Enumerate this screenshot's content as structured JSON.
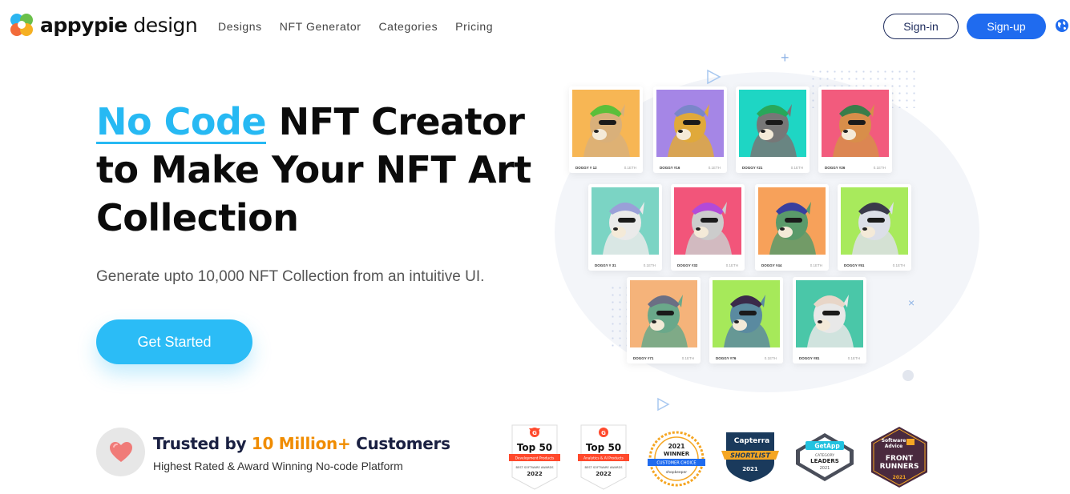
{
  "brand": {
    "logo_bold": "appypie",
    "logo_light": " design",
    "logo_icon": "appypie-logo-icon"
  },
  "nav": {
    "items": [
      {
        "label": "Designs"
      },
      {
        "label": "NFT Generator"
      },
      {
        "label": "Categories"
      },
      {
        "label": "Pricing"
      }
    ]
  },
  "header": {
    "signin_label": "Sign-in",
    "signup_label": "Sign-up",
    "language_icon": "globe-icon"
  },
  "hero": {
    "title_highlight": "No Code",
    "title_rest_1": " NFT Creator",
    "title_line_2": "to Make Your NFT Art",
    "title_line_3": "Collection",
    "subtitle": "Generate upto 10,000 NFT Collection from an intuitive UI.",
    "cta_label": "Get Started"
  },
  "trust": {
    "title_prefix": "Trusted by ",
    "title_highlight": "10 Million+",
    "title_suffix": " Customers",
    "subtitle": "Highest Rated & Award Winning No-code Platform",
    "icon": "heart-icon"
  },
  "badges": [
    {
      "name": "g2-top50-dev",
      "line1": "Top 50",
      "line2": "Development Products",
      "line3": "BEST SOFTWARE AWARDS",
      "year": "2022"
    },
    {
      "name": "g2-top50-ai",
      "line1": "Top 50",
      "line2": "Analytics & AI Products",
      "line3": "BEST SOFTWARE AWARDS",
      "year": "2022"
    },
    {
      "name": "capterra-winner",
      "line1": "2021",
      "line2": "WINNER",
      "line3": "CUSTOMER CHOICE",
      "line4": "shopkeeper"
    },
    {
      "name": "capterra-shortlist",
      "line1": "Capterra",
      "line2": "SHORTLIST",
      "year": "2021"
    },
    {
      "name": "getapp-leaders",
      "line1": "GetApp",
      "line2": "CATEGORY",
      "line3": "LEADERS",
      "year": "2021"
    },
    {
      "name": "software-advice",
      "line1": "Software",
      "line2": "Advice",
      "line3": "FRONT",
      "line4": "RUNNERS",
      "year": "2021"
    }
  ],
  "nft_cards": [
    {
      "name": "DOGGY # 12",
      "eth": "0.1ETH",
      "bg": "#f7b654",
      "hat": "#5bbf3a",
      "fur": "#d9b07a"
    },
    {
      "name": "DOGGY #16",
      "eth": "0.1ETH",
      "bg": "#a586e6",
      "hat": "#7a86c9",
      "fur": "#e0a93a"
    },
    {
      "name": "DOGGY #21",
      "eth": "0.1ETH",
      "bg": "#1ed6c4",
      "hat": "#28a85a",
      "fur": "#777777"
    },
    {
      "name": "DOGGY #26",
      "eth": "0.1ETH",
      "bg": "#f25b7d",
      "hat": "#3a7d4a",
      "fur": "#d88e4a"
    },
    {
      "name": "DOGGY # 31",
      "eth": "0.1ETH",
      "bg": "#7bd4c4",
      "hat": "#9aa0d8",
      "fur": "#eaeaea"
    },
    {
      "name": "DOGGY #32",
      "eth": "0.1ETH",
      "bg": "#f2557a",
      "hat": "#b34ad8",
      "fur": "#cccccc"
    },
    {
      "name": "DOGGY #44",
      "eth": "0.1ETH",
      "bg": "#f7a15a",
      "hat": "#3a3f9e",
      "fur": "#5a9a6a"
    },
    {
      "name": "DOGGY #51",
      "eth": "0.1ETH",
      "bg": "#a8ea5c",
      "hat": "#3a3a4a",
      "fur": "#dcdfe8"
    },
    {
      "name": "DOGGY #71",
      "eth": "0.1ETH",
      "bg": "#f5b37a",
      "hat": "#6b6f84",
      "fur": "#6aa88a"
    },
    {
      "name": "DOGGY #76",
      "eth": "0.1ETH",
      "bg": "#a6e95a",
      "hat": "#3a2a4a",
      "fur": "#5a8aa0"
    },
    {
      "name": "DOGGY #81",
      "eth": "0.1ETH",
      "bg": "#4ac7a8",
      "hat": "#e8d6c8",
      "fur": "#e8e8e8"
    }
  ],
  "colors": {
    "accent": "#27b9f3",
    "primary_button": "#1f6bef",
    "cta": "#2bbcf6",
    "trust_highlight": "#f08c00"
  }
}
